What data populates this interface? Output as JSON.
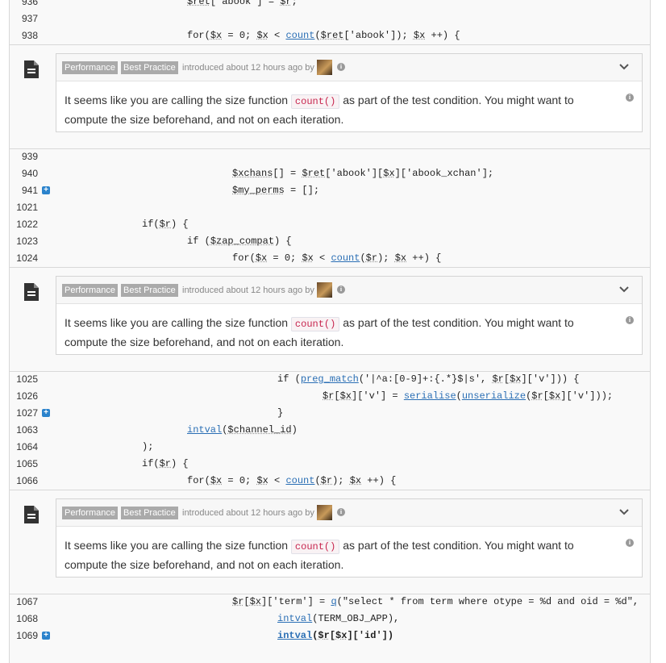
{
  "issues": [
    {
      "tags": [
        "Performance",
        "Best Practice"
      ],
      "introduced": "introduced about 12 hours ago by",
      "message_before": "It seems like you are calling the size function",
      "message_code": "count()",
      "message_after": "as part of the test condition. You might want to compute the size beforehand, and not on each iteration."
    },
    {
      "tags": [
        "Performance",
        "Best Practice"
      ],
      "introduced": "introduced about 12 hours ago by",
      "message_before": "It seems like you are calling the size function",
      "message_code": "count()",
      "message_after": "as part of the test condition. You might want to compute the size beforehand, and not on each iteration."
    },
    {
      "tags": [
        "Performance",
        "Best Practice"
      ],
      "introduced": "introduced about 12 hours ago by",
      "message_before": "It seems like you are calling the size function",
      "message_code": "count()",
      "message_after": "as part of the test condition. You might want to compute the size beforehand, and not on each iteration."
    }
  ],
  "code_lines": [
    {
      "n": "936",
      "t": "$ret['abook'] = $r;"
    },
    {
      "n": "937",
      "t": ""
    },
    {
      "n": "938",
      "t": "for($x = 0; $x < count($ret['abook']); $x ++) {"
    },
    {
      "n": "939",
      "t": ""
    },
    {
      "n": "940",
      "t": "$xchans[] = $ret['abook'][$x]['abook_xchan'];"
    },
    {
      "n": "941",
      "t": "$my_perms = [];",
      "plus": true
    },
    {
      "n": "1021",
      "t": ""
    },
    {
      "n": "1022",
      "t": "if($r) {"
    },
    {
      "n": "1023",
      "t": "if ($zap_compat) {"
    },
    {
      "n": "1024",
      "t": "for($x = 0; $x < count($r); $x ++) {"
    },
    {
      "n": "1025",
      "t": "if (preg_match('|^a:[0-9]+:{.*}$|s', $r[$x]['v'])) {"
    },
    {
      "n": "1026",
      "t": "$r[$x]['v'] = serialise(unserialize($r[$x]['v']));"
    },
    {
      "n": "1027",
      "t": "}",
      "plus": true
    },
    {
      "n": "1063",
      "t": "intval($channel_id)"
    },
    {
      "n": "1064",
      "t": ");"
    },
    {
      "n": "1065",
      "t": "if($r) {"
    },
    {
      "n": "1066",
      "t": "for($x = 0; $x < count($r); $x ++) {"
    },
    {
      "n": "1067",
      "t": "$r[$x]['term'] = q(\"select * from term where otype = %d and oid = %d\","
    },
    {
      "n": "1068",
      "t": "intval(TERM_OBJ_APP),"
    },
    {
      "n": "1069",
      "t": "intval($r[$x]['id'])",
      "plus": true
    }
  ]
}
